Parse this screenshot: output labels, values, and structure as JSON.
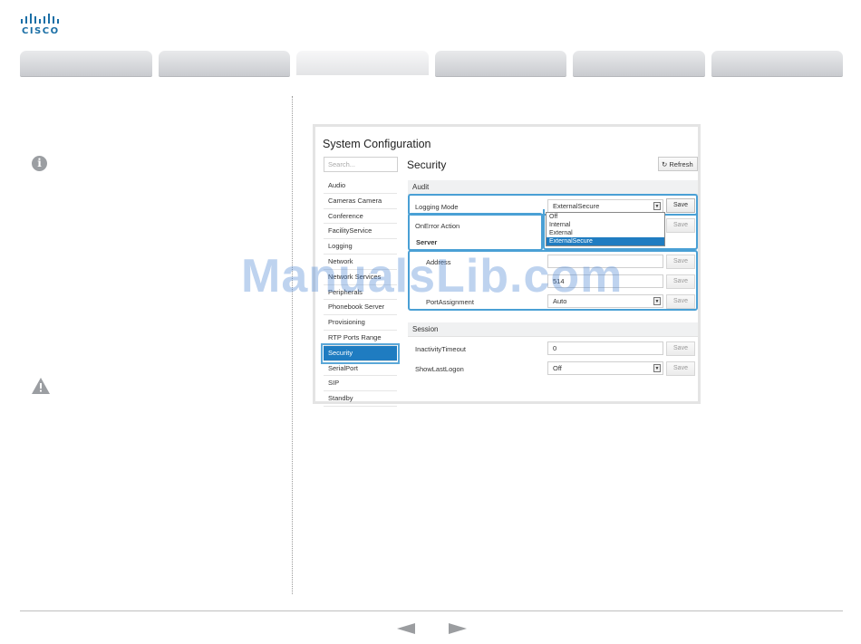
{
  "logo": {
    "text": "CISCO"
  },
  "tabs": [
    "",
    "",
    "",
    "",
    "",
    ""
  ],
  "active_tab_index": 2,
  "screen": {
    "title": "System Configuration",
    "search_placeholder": "Search...",
    "section_title": "Security",
    "refresh_label": "Refresh",
    "nav_items": [
      "Audio",
      "Cameras Camera",
      "Conference",
      "FacilityService",
      "Logging",
      "Network",
      "Network Services",
      "Peripherals",
      "Phonebook Server",
      "Provisioning",
      "RTP Ports Range",
      "Security",
      "SerialPort",
      "SIP",
      "Standby"
    ],
    "active_nav": "Security",
    "audit": {
      "header": "Audit",
      "logging_mode_label": "Logging Mode",
      "logging_mode_value": "ExternalSecure",
      "on_error_label": "OnError Action",
      "server_header": "Server",
      "address_label": "Address",
      "port_value": "514",
      "port_assignment_label": "PortAssignment",
      "port_assignment_value": "Auto",
      "dropdown_options": [
        "Off",
        "Internal",
        "External",
        "ExternalSecure"
      ],
      "dropdown_selected": "ExternalSecure"
    },
    "session": {
      "header": "Session",
      "inactivity_label": "InactivityTimeout",
      "inactivity_value": "0",
      "show_last_logon_label": "ShowLastLogon",
      "show_last_logon_value": "Off"
    },
    "save_label": "Save"
  },
  "watermark": "ManualsLib.com",
  "colors": {
    "accent": "#1f7cc1",
    "highlight": "#4aa0d5",
    "logo": "#1b6fa6"
  }
}
